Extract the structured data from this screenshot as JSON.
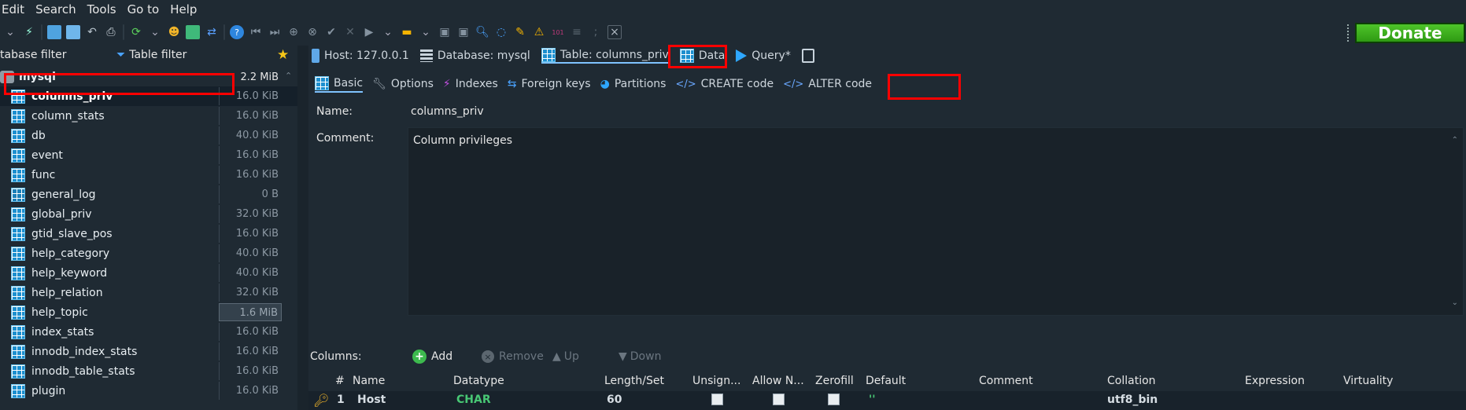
{
  "menu": [
    "Edit",
    "Search",
    "Tools",
    "Go to",
    "Help"
  ],
  "toolbar": {
    "donate_label": "Donate"
  },
  "sidebar": {
    "db_filter_label": "tabase filter",
    "table_filter_label": "Table filter",
    "database": {
      "name": "mysql",
      "size": "2.2 MiB"
    },
    "tables": [
      {
        "name": "columns_priv",
        "size": "16.0 KiB"
      },
      {
        "name": "column_stats",
        "size": "16.0 KiB"
      },
      {
        "name": "db",
        "size": "40.0 KiB"
      },
      {
        "name": "event",
        "size": "16.0 KiB"
      },
      {
        "name": "func",
        "size": "16.0 KiB"
      },
      {
        "name": "general_log",
        "size": "0 B"
      },
      {
        "name": "global_priv",
        "size": "32.0 KiB"
      },
      {
        "name": "gtid_slave_pos",
        "size": "16.0 KiB"
      },
      {
        "name": "help_category",
        "size": "40.0 KiB"
      },
      {
        "name": "help_keyword",
        "size": "40.0 KiB"
      },
      {
        "name": "help_relation",
        "size": "32.0 KiB"
      },
      {
        "name": "help_topic",
        "size": "1.6 MiB"
      },
      {
        "name": "index_stats",
        "size": "16.0 KiB"
      },
      {
        "name": "innodb_index_stats",
        "size": "16.0 KiB"
      },
      {
        "name": "innodb_table_stats",
        "size": "16.0 KiB"
      },
      {
        "name": "plugin",
        "size": "16.0 KiB"
      }
    ]
  },
  "crumbs": {
    "host": "Host: 127.0.0.1",
    "database": "Database: mysql",
    "table": "Table: columns_priv",
    "data": "Data",
    "query": "Query*"
  },
  "subtabs": [
    "Basic",
    "Options",
    "Indexes",
    "Foreign keys",
    "Partitions",
    "CREATE code",
    "ALTER code"
  ],
  "form": {
    "name_label": "Name:",
    "name_value": "columns_priv",
    "comment_label": "Comment:",
    "comment_value": "Column privileges"
  },
  "columns_bar": {
    "label": "Columns:",
    "add": "Add",
    "remove": "Remove",
    "up": "Up",
    "down": "Down"
  },
  "grid": {
    "headers": [
      "#",
      "Name",
      "Datatype",
      "Length/Set",
      "Unsign...",
      "Allow N...",
      "Zerofill",
      "Default",
      "Comment",
      "Collation",
      "Expression",
      "Virtuality"
    ],
    "row": {
      "num": "1",
      "name": "Host",
      "datatype": "CHAR",
      "length": "60",
      "default": "''",
      "collation": "utf8_bin"
    }
  },
  "colors": {
    "accent": "#7fc3ff",
    "highlight_box": "#ff0000",
    "datatype": "#48c774",
    "donate": "#3cb521"
  }
}
